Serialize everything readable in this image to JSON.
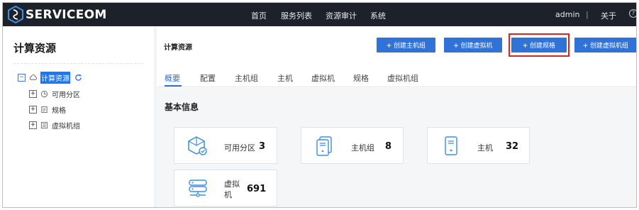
{
  "app": {
    "logo_text": "SERVICEOM"
  },
  "topnav": {
    "items": [
      "首页",
      "服务列表",
      "资源审计",
      "系统"
    ],
    "user": "admin",
    "separator": "|",
    "about": "关于",
    "help": "?"
  },
  "sidebar": {
    "title": "计算资源",
    "tree": {
      "root": {
        "toggle": "−",
        "label": "计算资源"
      },
      "children": [
        {
          "toggle": "+",
          "label": "可用分区",
          "icon": "zone-icon"
        },
        {
          "toggle": "+",
          "label": "规格",
          "icon": "flavor-icon"
        },
        {
          "toggle": "+",
          "label": "虚拟机组",
          "icon": "vm-group-icon"
        }
      ]
    }
  },
  "main": {
    "title": "计算资源",
    "buttons": [
      {
        "plus": "+",
        "label": "创建主机组"
      },
      {
        "plus": "+",
        "label": "创建虚拟机"
      },
      {
        "plus": "+",
        "label": "创建规格"
      },
      {
        "plus": "+",
        "label": "创建虚拟机组"
      }
    ],
    "tabs": [
      "概要",
      "配置",
      "主机组",
      "主机",
      "虚拟机",
      "规格",
      "虚拟机组"
    ],
    "active_tab": "概要",
    "section_title": "基本信息",
    "cards": [
      {
        "label": "可用分区",
        "value": "3",
        "icon": "availability-zone-icon"
      },
      {
        "label": "主机组",
        "value": "8",
        "icon": "host-group-icon"
      },
      {
        "label": "主机",
        "value": "32",
        "icon": "host-icon"
      },
      {
        "label_line1": "虚拟",
        "label_line2": "机",
        "value": "691",
        "icon": "vm-server-icon"
      }
    ]
  },
  "colors": {
    "topbar": "#1d2129",
    "accent": "#2f72d8",
    "highlight": "#d9251d",
    "icon_blue": "#3b8fe0"
  }
}
